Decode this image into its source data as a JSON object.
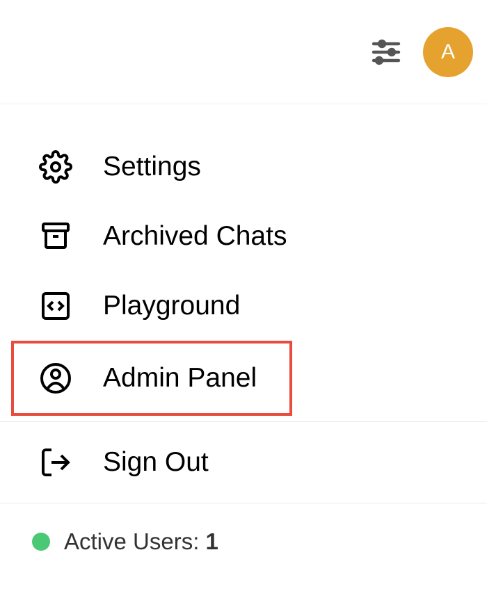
{
  "header": {
    "avatar_initial": "A"
  },
  "menu": {
    "items": [
      {
        "label": "Settings"
      },
      {
        "label": "Archived Chats"
      },
      {
        "label": "Playground"
      },
      {
        "label": "Admin Panel"
      },
      {
        "label": "Sign Out"
      }
    ]
  },
  "status": {
    "label": "Active Users: ",
    "count": "1",
    "dot_color": "#4ac874"
  },
  "colors": {
    "avatar_bg": "#e6a22f",
    "highlight_border": "#e74c3c"
  }
}
